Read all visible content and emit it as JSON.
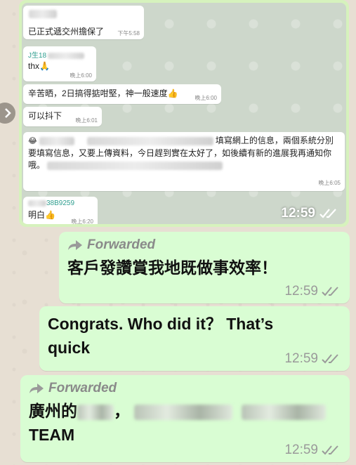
{
  "screenshot": {
    "messages": [
      {
        "text": "已正式遞交州擔保了",
        "time": "下午5:58"
      },
      {
        "sender": "J生18",
        "text": "thx🙏",
        "time": "晚上6:00"
      },
      {
        "text": "辛苦晒，2日搞得掂咁堅，神一般速度👍",
        "time": "晚上6:00"
      },
      {
        "text": "可以抖下",
        "time": "晚上6:01"
      },
      {
        "text_part1": "填寫網上的信息，兩個系統分別",
        "text_part2": "要填寫信息，又要上傳資料，今日趕到實在太好了，如後續有新的進展我再通知你",
        "text_part3": "哦。",
        "time": "晚上6:05"
      },
      {
        "sender": "38B9259",
        "text": "明白👍",
        "time": "晚上6:20"
      }
    ],
    "time": "12:59"
  },
  "bubbles": [
    {
      "forwarded_label": "Forwarded",
      "text": "客戶發讚賞我地既做事效率！",
      "time": "12:59"
    },
    {
      "text_line1": "Congrats.  Who did it？ That’s",
      "text_line2": "quick",
      "time": "12:59"
    },
    {
      "forwarded_label": "Forwarded",
      "text_prefix": "廣州的",
      "text_comma": "，",
      "text_line2": "TEAM",
      "time": "12:59"
    }
  ],
  "colors": {
    "outgoing_bubble": "#d9fdd3",
    "incoming_bubble": "#ffffff",
    "background": "#e7dfd3",
    "tick": "#9a9a9a"
  }
}
